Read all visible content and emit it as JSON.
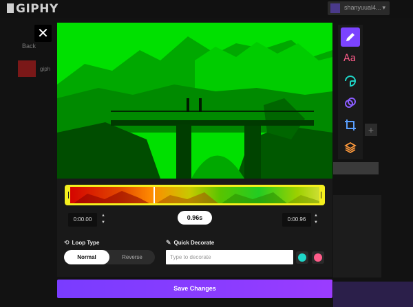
{
  "header": {
    "logo": "GIPHY",
    "username": "shanyuual4...",
    "caret": "▾"
  },
  "background": {
    "back_label": "Back",
    "thumb_label": "giph",
    "plus": "+"
  },
  "modal": {
    "close_glyph": "✕",
    "timeline": {
      "start_time": "0:00.00",
      "end_time": "0:00.96",
      "duration": "0.96s",
      "stepper_up": "▲",
      "stepper_down": "▼",
      "playhead_fraction": 0.34
    },
    "loop": {
      "title": "Loop Type",
      "icon": "loop-icon",
      "options": [
        "Normal",
        "Reverse"
      ],
      "selected": "Normal"
    },
    "decorate": {
      "title": "Quick Decorate",
      "icon": "pencil-icon",
      "placeholder": "Type to decorate"
    },
    "save_label": "Save Changes"
  },
  "toolbar": {
    "tools": [
      {
        "name": "draw-tool",
        "icon": "pencil-icon",
        "active": true
      },
      {
        "name": "text-tool",
        "icon": "text-icon",
        "label": "Aa"
      },
      {
        "name": "sticker-tool",
        "icon": "sticker-icon"
      },
      {
        "name": "filter-tool",
        "icon": "filter-icon"
      },
      {
        "name": "crop-tool",
        "icon": "crop-icon"
      },
      {
        "name": "layers-tool",
        "icon": "layers-icon"
      }
    ]
  },
  "colors": {
    "accent": "#7b43ff",
    "preview_green": "#00e000",
    "timeline_border": "#f5f01e",
    "text_tool": "#ff5c8a",
    "sticker_tool": "#1fd6c8",
    "filter_tool": "#8a5cff",
    "crop_tool": "#5aa0ff",
    "layers_tool": "#ff9a3c"
  }
}
